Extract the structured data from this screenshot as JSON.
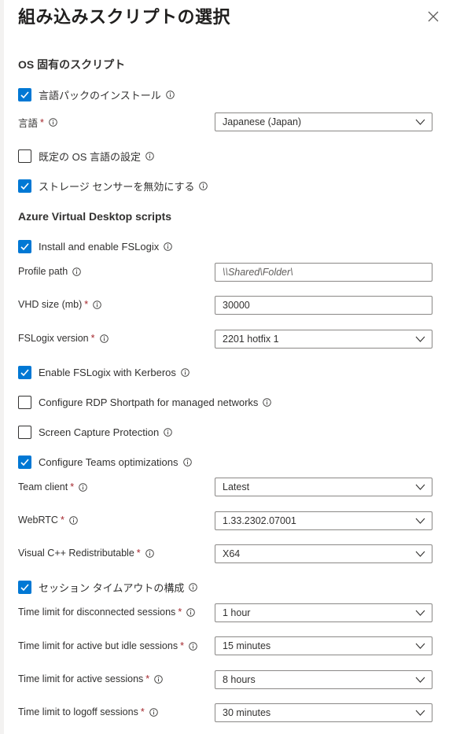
{
  "panel": {
    "title": "組み込みスクリプトの選択"
  },
  "os_section": {
    "title": "OS 固有のスクリプト",
    "language_pack": {
      "label": "言語パックのインストール",
      "checked": true
    },
    "language": {
      "label": "言語",
      "value": "Japanese (Japan)"
    },
    "default_language": {
      "label": "既定の OS 言語の設定",
      "checked": false
    },
    "storage_sense": {
      "label": "ストレージ センサーを無効にする",
      "checked": true
    }
  },
  "avd_section": {
    "title": "Azure Virtual Desktop scripts",
    "fslogix": {
      "label": "Install and enable FSLogix",
      "checked": true
    },
    "profile_path": {
      "label": "Profile path",
      "placeholder": "\\\\Shared\\Folder\\"
    },
    "vhd_size": {
      "label": "VHD size (mb)",
      "value": "30000"
    },
    "fslogix_version": {
      "label": "FSLogix version",
      "value": "2201 hotfix 1"
    },
    "kerberos": {
      "label": "Enable FSLogix with Kerberos",
      "checked": true
    },
    "rdp_shortpath": {
      "label": "Configure RDP Shortpath for managed networks",
      "checked": false
    },
    "screen_capture": {
      "label": "Screen Capture Protection",
      "checked": false
    },
    "teams": {
      "label": "Configure Teams optimizations",
      "checked": true
    },
    "team_client": {
      "label": "Team client",
      "value": "Latest"
    },
    "webrtc": {
      "label": "WebRTC",
      "value": "1.33.2302.07001"
    },
    "vcpp": {
      "label": "Visual C++ Redistributable",
      "value": "X64"
    },
    "session_timeout": {
      "label": "セッション タイムアウトの構成",
      "checked": true
    },
    "disconnected": {
      "label": "Time limit for disconnected sessions",
      "value": "1 hour"
    },
    "idle": {
      "label": "Time limit for active but idle sessions",
      "value": "15 minutes"
    },
    "active": {
      "label": "Time limit for active sessions",
      "value": "8 hours"
    },
    "logoff": {
      "label": "Time limit to logoff sessions",
      "value": "30 minutes"
    }
  },
  "required_marker": "*",
  "icons": {
    "close": "close-icon",
    "info": "info-icon",
    "chevron": "chevron-down-icon",
    "check": "checkmark-icon"
  },
  "colors": {
    "accent": "#0078d4",
    "required": "#a4262c",
    "text": "#323130"
  }
}
